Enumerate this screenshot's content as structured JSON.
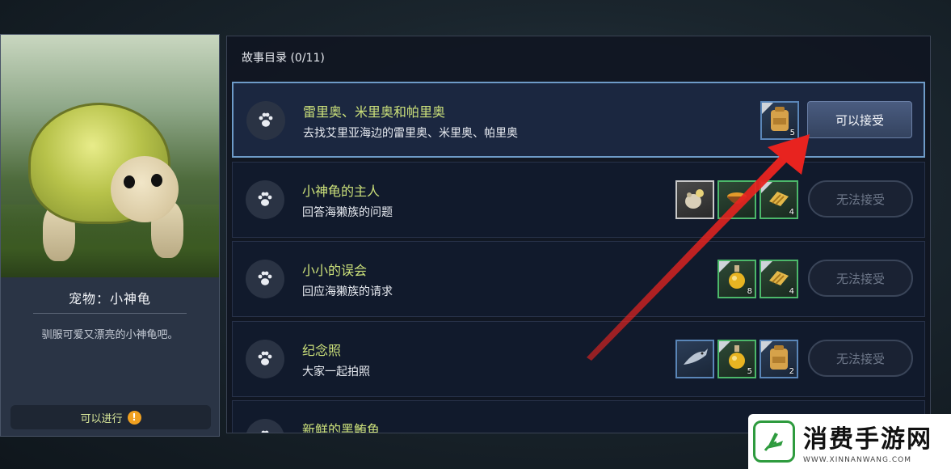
{
  "pet_card": {
    "name": "宠物：小神龟",
    "description": "驯服可爱又漂亮的小神龟吧。",
    "status_label": "可以进行",
    "status_icon": "exclamation-icon"
  },
  "quest_panel": {
    "title": "故事目录 (0/11)",
    "quests": [
      {
        "title": "雷里奥、米里奥和帕里奥",
        "subtitle": "去找艾里亚海边的雷里奥、米里奥、帕里奥",
        "selected": true,
        "rewards": [
          {
            "icon": "backpack-icon",
            "count": "5",
            "style": "blue"
          }
        ],
        "button_label": "可以接受",
        "button_enabled": true
      },
      {
        "title": "小神龟的主人",
        "subtitle": "回答海獭族的问题",
        "selected": false,
        "rewards": [
          {
            "icon": "grain-sack-icon",
            "count": "",
            "style": "gray"
          },
          {
            "icon": "food-bowl-icon",
            "count": "",
            "style": "green"
          },
          {
            "icon": "bread-icon",
            "count": "4",
            "style": "green"
          }
        ],
        "button_label": "无法接受",
        "button_enabled": false
      },
      {
        "title": "小小的误会",
        "subtitle": "回应海獭族的请求",
        "selected": false,
        "rewards": [
          {
            "icon": "potion-icon",
            "count": "8",
            "style": "green"
          },
          {
            "icon": "bread-icon",
            "count": "4",
            "style": "green"
          }
        ],
        "button_label": "无法接受",
        "button_enabled": false
      },
      {
        "title": "纪念照",
        "subtitle": "大家一起拍照",
        "selected": false,
        "rewards": [
          {
            "icon": "fish-icon",
            "count": "",
            "style": "blue"
          },
          {
            "icon": "potion-icon",
            "count": "5",
            "style": "green"
          },
          {
            "icon": "backpack-icon",
            "count": "2",
            "style": "blue"
          }
        ],
        "button_label": "无法接受",
        "button_enabled": false
      },
      {
        "title": "新鲜的黑鲔鱼",
        "subtitle": "",
        "selected": false,
        "rewards": [],
        "button_label": "",
        "button_enabled": false
      }
    ]
  },
  "watermark": {
    "title": "消费手游网",
    "url": "WWW.XINNANWANG.COM"
  },
  "colors": {
    "quest_title": "#cbe07a",
    "selected_border": "#6e9bc8",
    "arrow": "#e8231f",
    "watermark_green": "#2e9b3e"
  }
}
